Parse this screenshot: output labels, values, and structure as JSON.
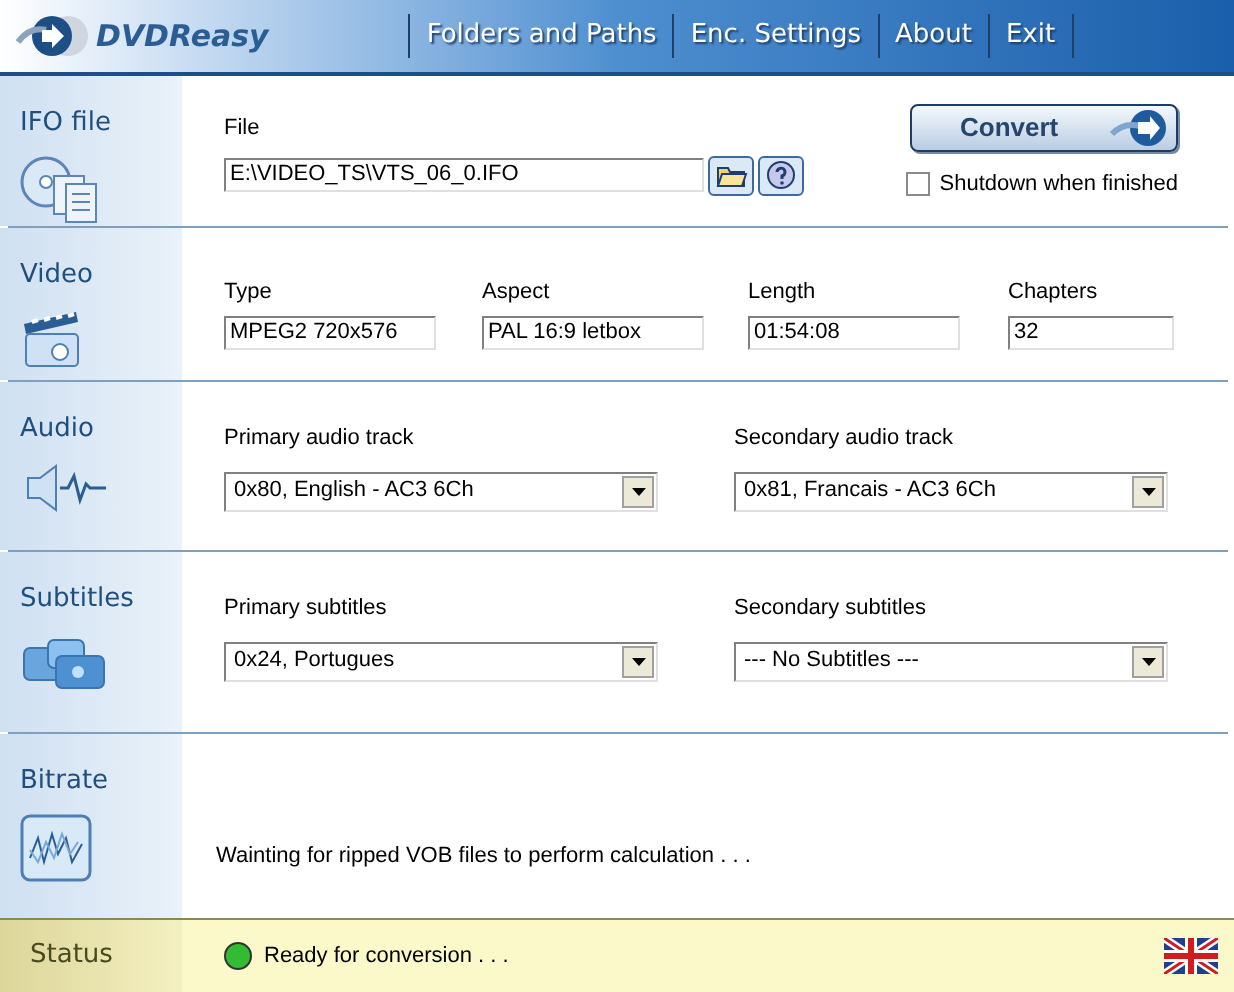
{
  "header": {
    "logo": "DVDReasy",
    "menu": [
      "Folders and Paths",
      "Enc. Settings",
      "About",
      "Exit"
    ]
  },
  "sections": [
    {
      "kind": "ifo",
      "title": "IFO file",
      "file_label": "File",
      "file_value": "E:\\VIDEO_TS\\VTS_06_0.IFO",
      "convert": "Convert",
      "shutdown": {
        "label": "Shutdown when finished",
        "checked": false
      }
    },
    {
      "kind": "video",
      "title": "Video",
      "fields": [
        {
          "label": "Type",
          "value": "MPEG2 720x576"
        },
        {
          "label": "Aspect",
          "value": "PAL 16:9 letbox"
        },
        {
          "label": "Length",
          "value": "01:54:08"
        },
        {
          "label": "Chapters",
          "value": "32"
        }
      ]
    },
    {
      "kind": "audio",
      "title": "Audio",
      "selects": [
        {
          "label": "Primary audio track",
          "value": "0x80, English - AC3 6Ch"
        },
        {
          "label": "Secondary audio track",
          "value": "0x81, Francais - AC3 6Ch"
        }
      ]
    },
    {
      "kind": "subtitles",
      "title": "Subtitles",
      "selects": [
        {
          "label": "Primary subtitles",
          "value": "0x24, Portugues"
        },
        {
          "label": "Secondary subtitles",
          "value": "--- No Subtitles ---"
        }
      ]
    },
    {
      "kind": "bitrate",
      "title": "Bitrate",
      "message": "Wainting for ripped VOB files to perform calculation . . ."
    }
  ],
  "status": {
    "title": "Status",
    "text": "Ready for conversion . . .",
    "color": "#33bb33"
  }
}
